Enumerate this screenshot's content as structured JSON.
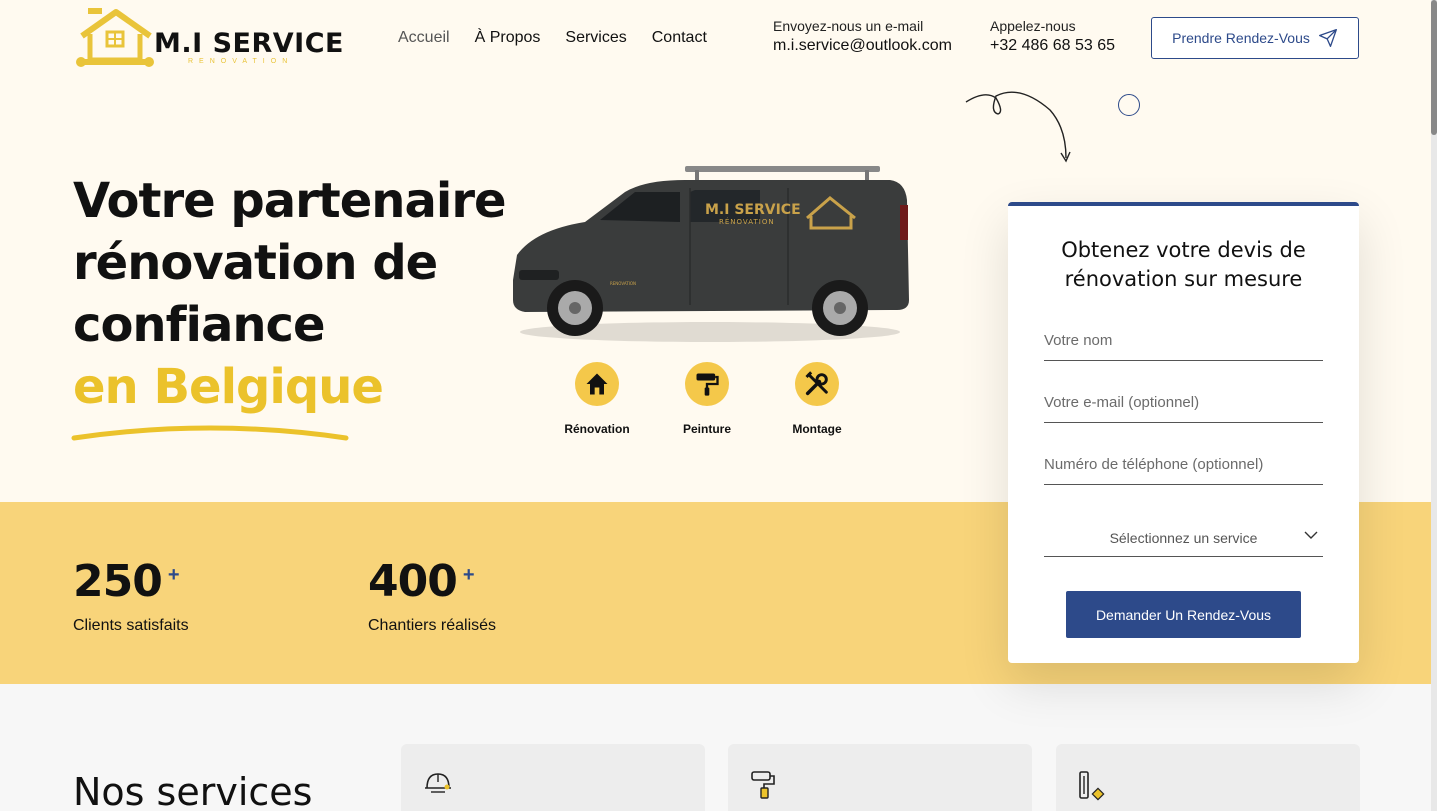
{
  "brand": {
    "name": "M.I SERVICE",
    "tagline": "RENOVATION"
  },
  "nav": {
    "items": [
      {
        "label": "Accueil"
      },
      {
        "label": "À Propos"
      },
      {
        "label": "Services"
      },
      {
        "label": "Contact"
      }
    ]
  },
  "contact": {
    "email_label": "Envoyez-nous un e-mail",
    "email": "m.i.service@outlook.com",
    "phone_label": "Appelez-nous",
    "phone": "+32 486 68 53 65"
  },
  "header_cta": {
    "label": "Prendre Rendez-Vous",
    "icon": "send-icon"
  },
  "hero": {
    "title_lines": [
      "Votre partenaire",
      "rénovation de",
      "confiance"
    ],
    "highlight": "en Belgique",
    "highlight_color": "#ebc22b"
  },
  "van": {
    "brand": "M.I SERVICE",
    "brand_sub": "RÉNOVATION",
    "door_text": "RENOVATION"
  },
  "services_icons": [
    {
      "label": "Rénovation",
      "icon": "house-icon"
    },
    {
      "label": "Peinture",
      "icon": "paint-roller-icon"
    },
    {
      "label": "Montage",
      "icon": "tools-icon"
    }
  ],
  "stats": [
    {
      "value": "250",
      "suffix": "+",
      "label": "Clients satisfaits"
    },
    {
      "value": "400",
      "suffix": "+",
      "label": "Chantiers réalisés"
    }
  ],
  "form": {
    "title": "Obtenez votre devis de rénovation sur mesure",
    "name_placeholder": "Votre nom",
    "email_placeholder": "Votre e-mail (optionnel)",
    "phone_placeholder": "Numéro de téléphone (optionnel)",
    "service_select": "Sélectionnez un service",
    "submit_label": "Demander Un Rendez-Vous"
  },
  "services_section": {
    "title": "Nos services",
    "cards": [
      {
        "icon": "helmet-icon"
      },
      {
        "icon": "paint-roller-icon"
      },
      {
        "icon": "spirit-level-icon"
      }
    ]
  },
  "colors": {
    "accent": "#2d4a8a",
    "yellow": "#f8d47a",
    "highlight": "#ebc22b",
    "background": "#fffaf0"
  }
}
